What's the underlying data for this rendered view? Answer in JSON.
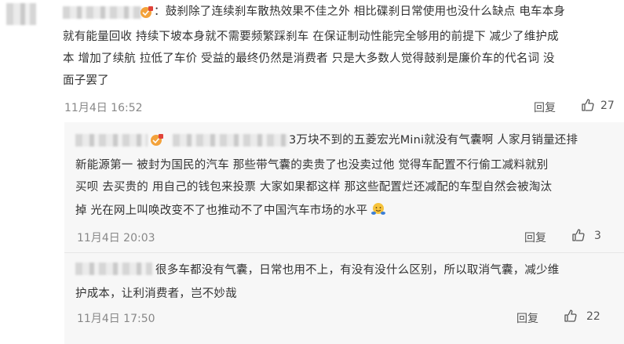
{
  "comments": [
    {
      "text_line1_after_name": "：鼓刹除了连续刹车散热效果不佳之外 相比碟刹日常使用也没什么缺点 电车本身",
      "text_line2": "就有能量回收 持续下坡本身就不需要频繁踩刹车 在保证制动性能完全够用的前提下 减少了维护成",
      "text_line3": "本 增加了续航 拉低了车价 受益的最终仍然是消费者 只是大多数人觉得鼓刹是廉价车的代名词 没",
      "text_line4": "面子罢了",
      "timestamp": "11月4日 16:52",
      "reply_label": "回复",
      "likes": "27"
    }
  ],
  "replies": [
    {
      "text_line1_after_name": "3万块不到的五菱宏光Mini就没有气囊啊 人家月销量还排",
      "text_line2": "新能源第一 被封为国民的汽车 那些带气囊的卖贵了也没卖过他 觉得车配置不行偷工减料就别",
      "text_line3": "买呗 去买贵的 用自己的钱包来投票 大家如果都这样 那这些配置烂还减配的车型自然会被淘汰",
      "text_line4": "掉 光在网上叫唤改变不了也推动不了中国汽车市场的水平",
      "timestamp": "11月4日 20:03",
      "reply_label": "回复",
      "likes": "3"
    },
    {
      "text_line1_after_name": "很多车都没有气囊，日常也用不上，有没有没什么区别，所以取消气囊，减少维",
      "text_line2": "护成本，让利消费者，岂不妙哉",
      "timestamp": "11月4日 17:50",
      "reply_label": "回复",
      "likes": "22"
    }
  ],
  "colors": {
    "text": "#333333",
    "meta": "#888888",
    "reply_bg": "#f7f7f7",
    "badge": "#f0a020"
  },
  "icons": [
    "thumbs-up-icon",
    "vip-badge-icon",
    "hug-emoji-icon"
  ]
}
